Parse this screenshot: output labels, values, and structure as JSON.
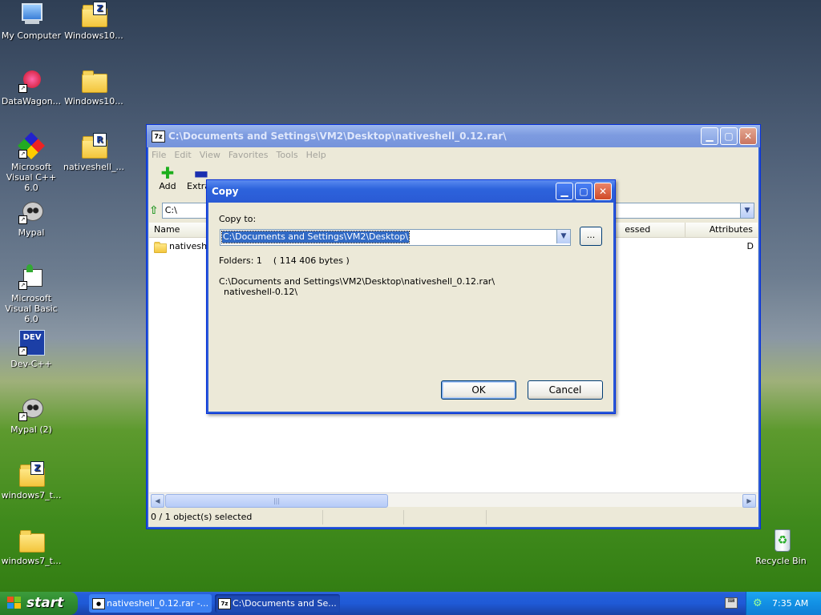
{
  "desktop": {
    "icons": [
      {
        "label": "My Computer"
      },
      {
        "label": "Windows10..."
      },
      {
        "label": "DataWagon..."
      },
      {
        "label": "Windows10..."
      },
      {
        "label": "Microsoft Visual C++ 6.0"
      },
      {
        "label": "nativeshell_..."
      },
      {
        "label": "Mypal"
      },
      {
        "label": "Microsoft Visual Basic 6.0"
      },
      {
        "label": "Dev-C++"
      },
      {
        "label": "Mypal (2)"
      },
      {
        "label": "windows7_t..."
      },
      {
        "label": "windows7_t..."
      },
      {
        "label": "Recycle Bin"
      }
    ]
  },
  "main_window": {
    "title": "C:\\Documents and Settings\\VM2\\Desktop\\nativeshell_0.12.rar\\",
    "app_icon": "7z",
    "menu": [
      "File",
      "Edit",
      "View",
      "Favorites",
      "Tools",
      "Help"
    ],
    "toolbar": [
      {
        "label": "Add",
        "icon": "plus-icon"
      },
      {
        "label": "Extract",
        "icon": "minus-icon"
      }
    ],
    "address_prefix": "C:\\",
    "columns": [
      "Name",
      "essed",
      "Attributes"
    ],
    "rows": [
      {
        "name": "nativeshel",
        "attr": "D"
      }
    ],
    "status": "0 / 1 object(s) selected"
  },
  "dialog": {
    "title": "Copy",
    "copy_to_label": "Copy to:",
    "path_value": "C:\\Documents and Settings\\VM2\\Desktop\\",
    "browse_label": "...",
    "folders_info": "Folders: 1    ( 114 406 bytes )",
    "source_line1": "C:\\Documents and Settings\\VM2\\Desktop\\nativeshell_0.12.rar\\",
    "source_line2": "nativeshell-0.12\\",
    "ok_label": "OK",
    "cancel_label": "Cancel"
  },
  "taskbar": {
    "start_label": "start",
    "tasks": [
      {
        "label": "nativeshell_0.12.rar -..."
      },
      {
        "label": "C:\\Documents and Se..."
      }
    ],
    "clock": "7:35 AM"
  }
}
